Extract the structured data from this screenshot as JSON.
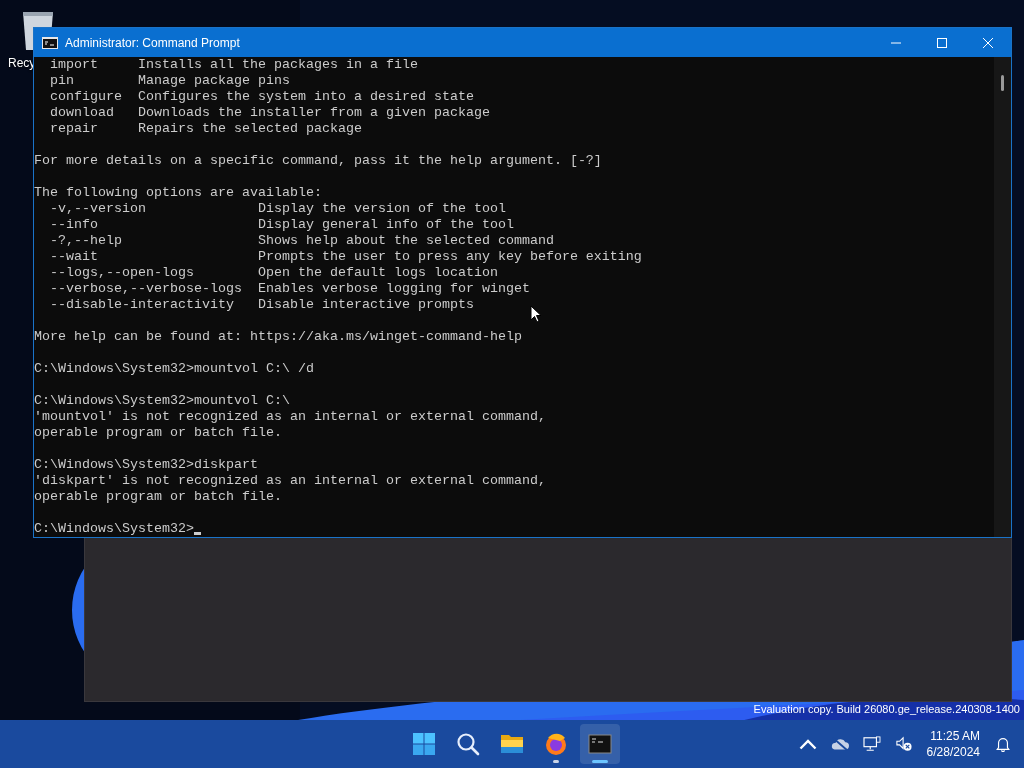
{
  "desktop_icon": {
    "label": "Recy"
  },
  "background_window": {
    "kind": "empty"
  },
  "watermark_text": "Evaluation copy. Build 26080.ge_release.240308-1400",
  "window": {
    "title": "Administrator: Command Prompt"
  },
  "console": {
    "blocks": [
      [
        "  import     Installs all the packages in a file",
        "  pin        Manage package pins",
        "  configure  Configures the system into a desired state",
        "  download   Downloads the installer from a given package",
        "  repair     Repairs the selected package"
      ],
      [
        "For more details on a specific command, pass it the help argument. [-?]"
      ],
      [
        "The following options are available:",
        "  -v,--version              Display the version of the tool",
        "  --info                    Display general info of the tool",
        "  -?,--help                 Shows help about the selected command",
        "  --wait                    Prompts the user to press any key before exiting",
        "  --logs,--open-logs        Open the default logs location",
        "  --verbose,--verbose-logs  Enables verbose logging for winget",
        "  --disable-interactivity   Disable interactive prompts"
      ],
      [
        "More help can be found at: https://aka.ms/winget-command-help"
      ],
      [
        "C:\\Windows\\System32>mountvol C:\\ /d"
      ],
      [
        "C:\\Windows\\System32>mountvol C:\\",
        "'mountvol' is not recognized as an internal or external command,",
        "operable program or batch file."
      ],
      [
        "C:\\Windows\\System32>diskpart",
        "'diskpart' is not recognized as an internal or external command,",
        "operable program or batch file."
      ]
    ],
    "prompt": "C:\\Windows\\System32>"
  },
  "taskbar": {
    "apps": [
      {
        "kind": "start",
        "running": false,
        "selected": false
      },
      {
        "kind": "search",
        "running": false,
        "selected": false
      },
      {
        "kind": "files",
        "running": false,
        "selected": false
      },
      {
        "kind": "browser",
        "running": true,
        "selected": false
      },
      {
        "kind": "terminal",
        "running": true,
        "selected": true
      }
    ],
    "clock": {
      "time": "11:25 AM",
      "date": "6/28/2024"
    }
  }
}
